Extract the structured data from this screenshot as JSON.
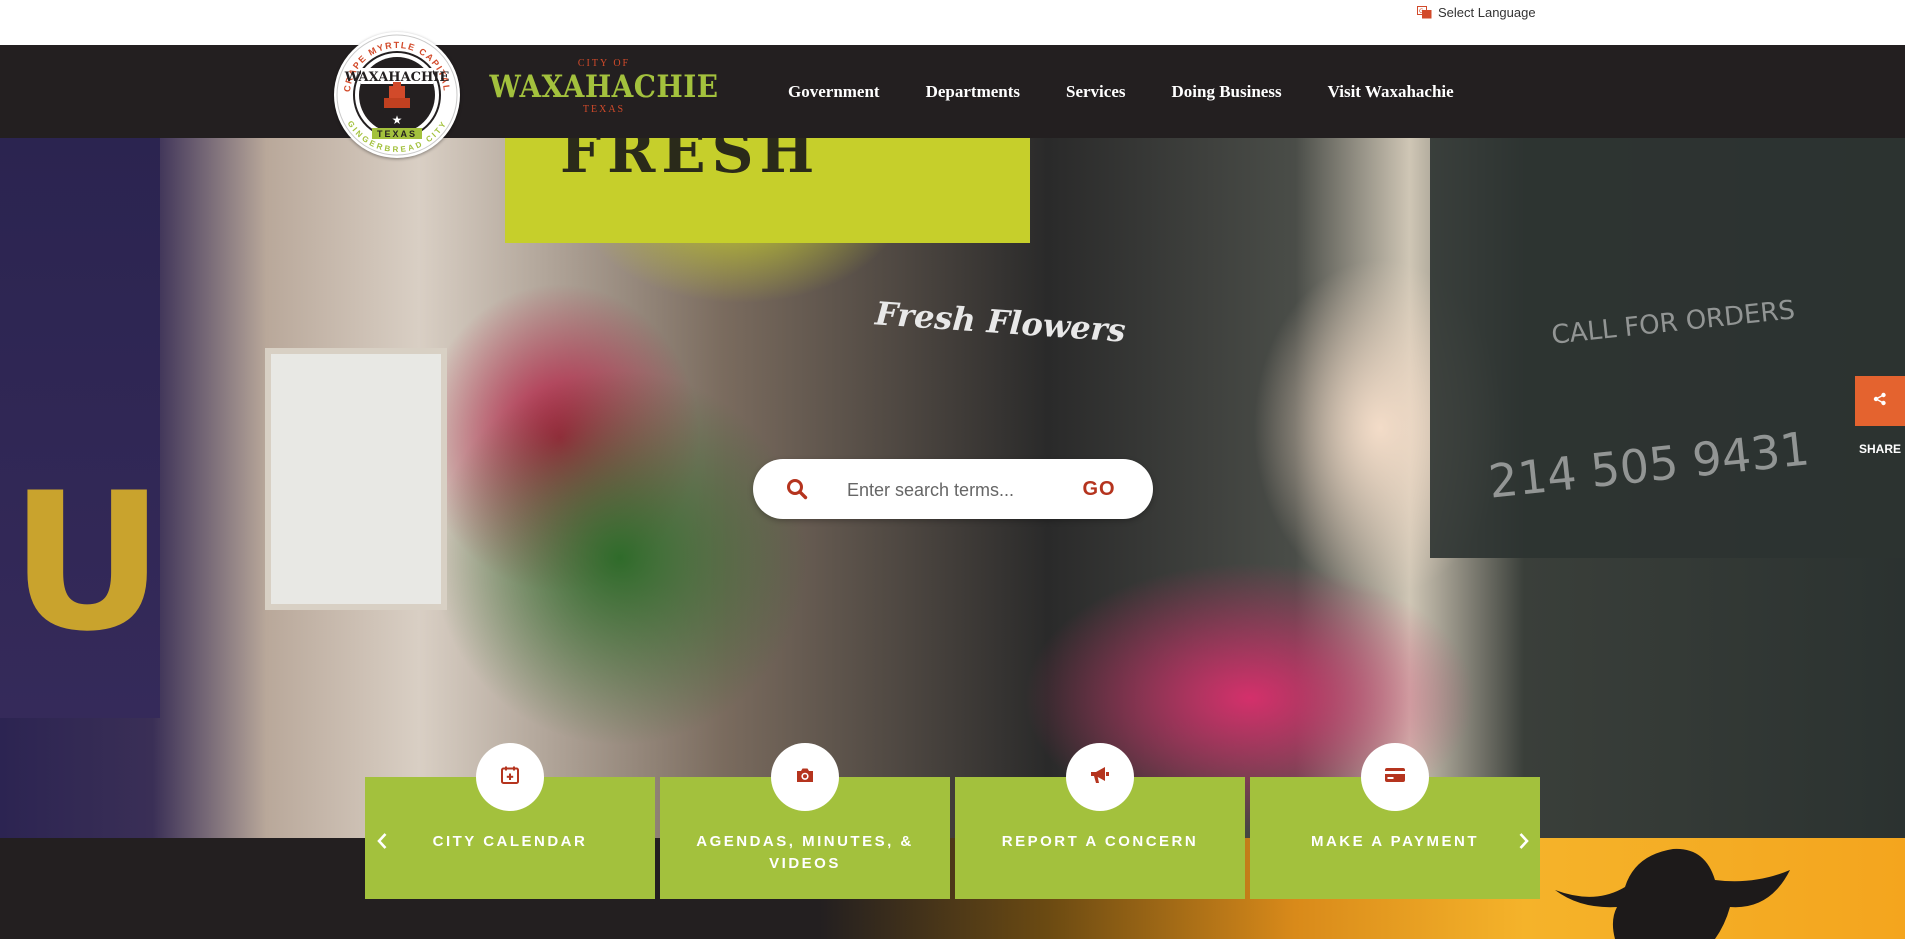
{
  "utility": {
    "language_label": "Select Language"
  },
  "branding": {
    "seal_top_text": "CRAPE MYRTLE CAPITAL",
    "seal_bottom_text": "GINGERBREAD CITY",
    "seal_name": "WAXAHACHIE",
    "seal_state": "TEXAS",
    "city_of": "CITY OF",
    "city_name": "WAXAHACHIE",
    "state": "TEXAS"
  },
  "nav": {
    "items": [
      {
        "label": "Government"
      },
      {
        "label": "Departments"
      },
      {
        "label": "Services"
      },
      {
        "label": "Doing Business"
      },
      {
        "label": "Visit Waxahachie"
      }
    ]
  },
  "hero": {
    "sign_text": "FRESH",
    "shop_text": "Fresh Flowers",
    "chalk_text": "CALL FOR ORDERS",
    "chalk_phone": "214 505 9431",
    "flag_letter": "U"
  },
  "search": {
    "placeholder": "Enter search terms...",
    "go_label": "GO"
  },
  "share": {
    "label": "SHARE"
  },
  "quicklinks": {
    "items": [
      {
        "label": "CITY CALENDAR",
        "icon": "calendar-icon"
      },
      {
        "label": "AGENDAS, MINUTES, & VIDEOS",
        "icon": "camera-icon"
      },
      {
        "label": "REPORT A CONCERN",
        "icon": "megaphone-icon"
      },
      {
        "label": "MAKE A PAYMENT",
        "icon": "credit-card-icon"
      }
    ],
    "prev_icon": "chevron-left-icon",
    "next_icon": "chevron-right-icon"
  },
  "colors": {
    "header_bg": "#231f20",
    "accent_green": "#a3c13d",
    "accent_red": "#b5341e",
    "share_orange": "#e4632f"
  }
}
